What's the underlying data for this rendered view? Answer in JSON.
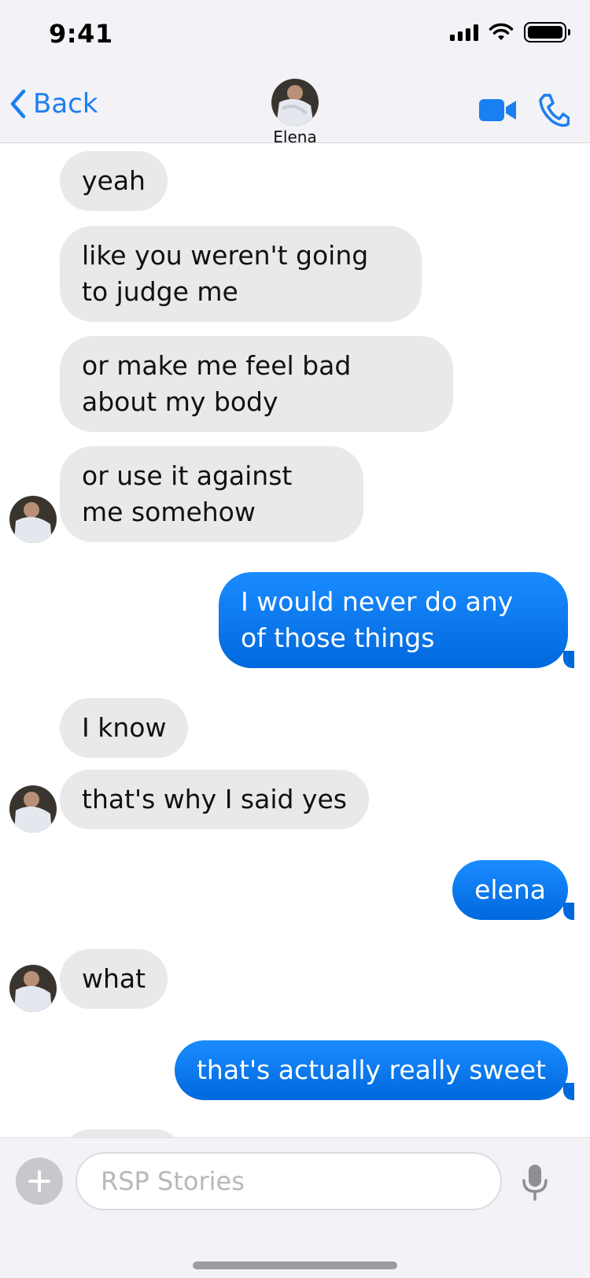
{
  "status_bar": {
    "time": "9:41"
  },
  "header": {
    "back_label": "Back",
    "contact_name": "Elena",
    "accent_color": "#1a7ff2",
    "actions": [
      "video-camera-icon",
      "phone-icon"
    ]
  },
  "messages": [
    {
      "direction": "incoming",
      "text": "yeah"
    },
    {
      "direction": "incoming",
      "text": "like you weren't going to judge me"
    },
    {
      "direction": "incoming",
      "text": "or make me feel bad about my body"
    },
    {
      "direction": "incoming",
      "text": "or use it against me somehow",
      "avatar": true
    },
    {
      "direction": "outgoing",
      "text": "I would never do any of those things"
    },
    {
      "direction": "incoming",
      "text": "I know"
    },
    {
      "direction": "incoming",
      "text": "that's why I said yes",
      "avatar": true
    },
    {
      "direction": "outgoing",
      "text": "elena"
    },
    {
      "direction": "incoming",
      "text": "what",
      "avatar": true
    },
    {
      "direction": "outgoing",
      "text": "that's actually really sweet"
    }
  ],
  "composer": {
    "placeholder": "RSP Stories",
    "icons": [
      "plus-icon",
      "microphone-icon"
    ]
  },
  "colors": {
    "incoming_bubble": "#e9e9eb",
    "outgoing_bubble": "#0a7cf0",
    "background": "#ffffff"
  }
}
